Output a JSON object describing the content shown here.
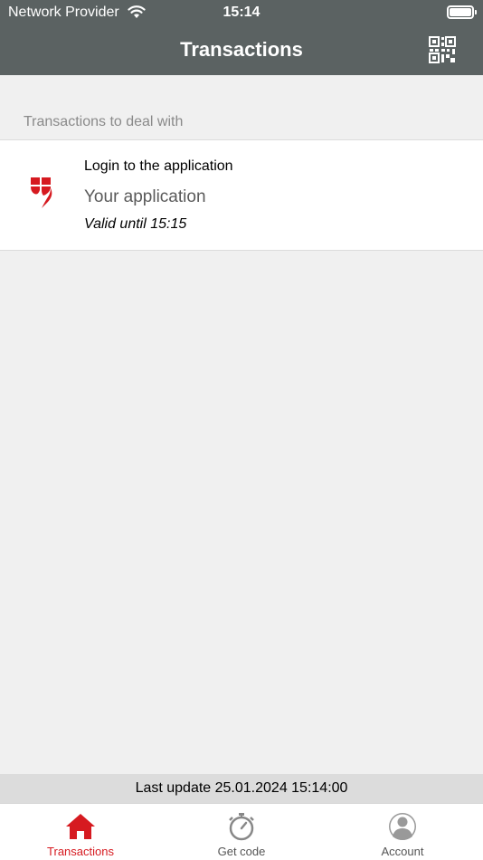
{
  "status_bar": {
    "carrier": "Network Provider",
    "time": "15:14"
  },
  "header": {
    "title": "Transactions",
    "qr_icon": "qr-code-icon"
  },
  "section": {
    "label": "Transactions to deal with"
  },
  "transactions": [
    {
      "title": "Login to the application",
      "app": "Your application",
      "validity": "Valid until 15:15",
      "icon": "bank-shield-logo-icon"
    }
  ],
  "footer": {
    "last_update": "Last update 25.01.2024 15:14:00"
  },
  "tabbar": {
    "tabs": [
      {
        "label": "Transactions",
        "icon": "home-icon",
        "active": true
      },
      {
        "label": "Get code",
        "icon": "stopwatch-icon",
        "active": false
      },
      {
        "label": "Account",
        "icon": "person-icon",
        "active": false
      }
    ]
  },
  "colors": {
    "header_bg": "#5b6262",
    "accent": "#d61a20",
    "page_bg": "#f0f0f0"
  }
}
